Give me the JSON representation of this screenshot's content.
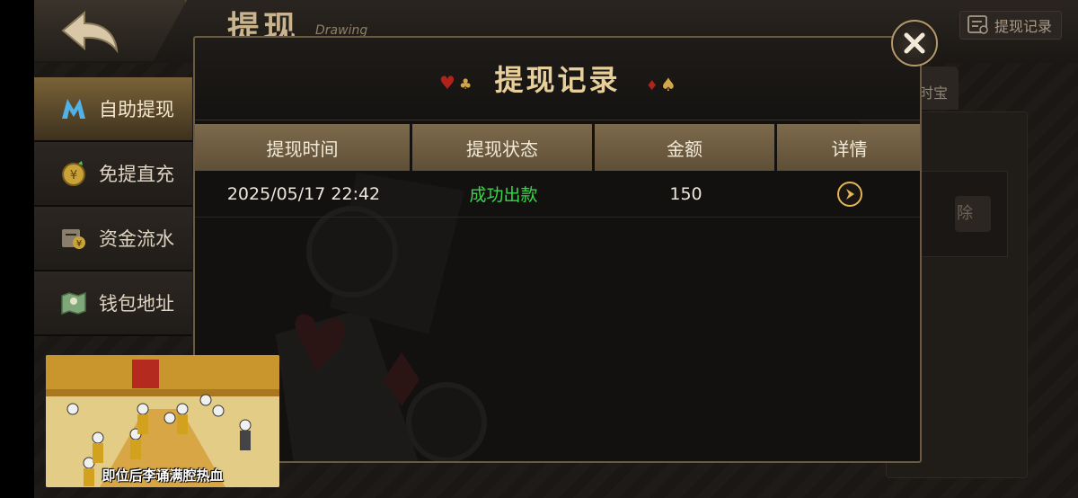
{
  "header": {
    "title": "提现",
    "subtitle": "Drawing",
    "record_button_label": "提现记录"
  },
  "sidebar": {
    "items": [
      {
        "label": "自助提现",
        "icon": "m-logo-icon",
        "active": true
      },
      {
        "label": "免提直充",
        "icon": "coin-icon",
        "active": false
      },
      {
        "label": "资金流水",
        "icon": "ledger-icon",
        "active": false
      },
      {
        "label": "钱包地址",
        "icon": "map-icon",
        "active": false
      }
    ]
  },
  "background": {
    "tab_partial": "时宝",
    "button_partial": "除"
  },
  "dialog": {
    "title": "提现记录",
    "columns": [
      "提现时间",
      "提现状态",
      "金额",
      "详情"
    ],
    "rows": [
      {
        "time": "2025/05/17 22:42",
        "status": "成功出款",
        "amount": "150",
        "detail_icon": "arrow-right-icon"
      }
    ]
  },
  "video_overlay": {
    "caption": "即位后李诵满腔热血"
  },
  "colors": {
    "accent_gold": "#e8cf9a",
    "success_green": "#3bd64a",
    "table_header": "#7d6a4c"
  }
}
